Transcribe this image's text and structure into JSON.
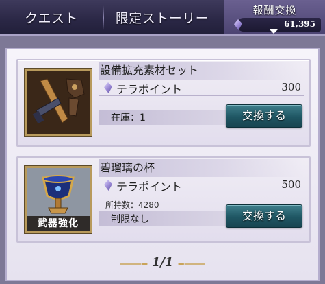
{
  "tabs": {
    "quest": "クエスト",
    "story": "限定ストーリー",
    "reward": {
      "title": "報酬交換",
      "currency_icon": "crystal-icon",
      "balance": "61,395"
    }
  },
  "items": [
    {
      "name": "設備拡充素材セット",
      "cost_icon": "crystal-icon",
      "cost_label": "テラポイント",
      "cost_value": "300",
      "stock": "在庫：1",
      "button": "交換する"
    },
    {
      "name": "碧瑠璃の杯",
      "cost_icon": "crystal-icon",
      "cost_label": "テラポイント",
      "cost_value": "500",
      "owned": "所持数：4280",
      "limit": "制限なし",
      "badge": "武器強化",
      "button": "交換する"
    }
  ],
  "pager": {
    "text": "1/1"
  },
  "colors": {
    "header_bg": "#2a2745",
    "button_bg": "#1f5663",
    "panel_bg": "#f0edf5",
    "frame_gold": "#b89a5c"
  }
}
